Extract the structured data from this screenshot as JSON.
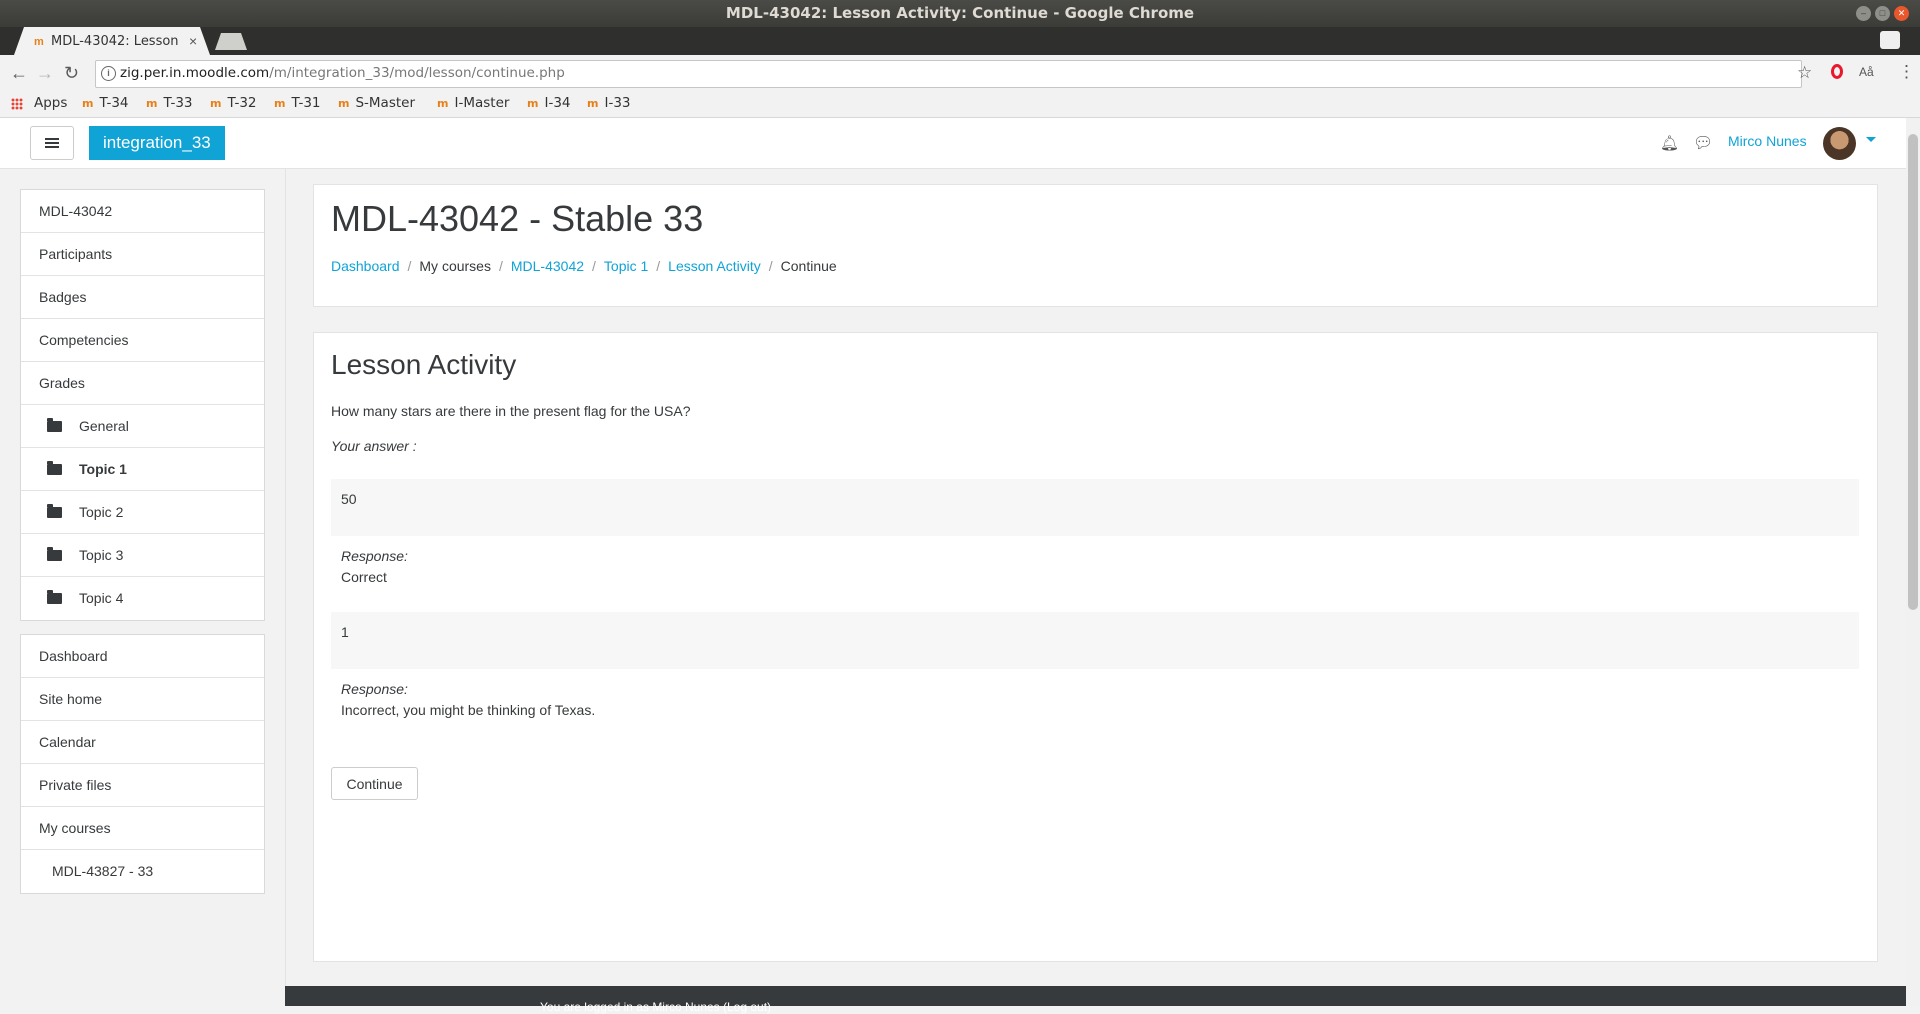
{
  "window": {
    "title": "MDL-43042: Lesson Activity: Continue - Google Chrome"
  },
  "browser": {
    "tab_title": "MDL-43042: Lesson",
    "tab_close": "×",
    "url_host": "zig.per.in.moodle.com",
    "url_path": "/m/integration_33/mod/lesson/continue.php",
    "bookmarks": [
      "Apps",
      "T-34",
      "T-33",
      "T-32",
      "T-31",
      "S-Master",
      "I-Master",
      "I-34",
      "I-33"
    ],
    "translate_label": "Aå"
  },
  "navbar": {
    "site_name": "integration_33",
    "user_name": "Mirco Nunes"
  },
  "drawer": {
    "course_items": [
      {
        "label": "MDL-43042"
      },
      {
        "label": "Participants"
      },
      {
        "label": "Badges"
      },
      {
        "label": "Competencies"
      },
      {
        "label": "Grades"
      },
      {
        "label": "General"
      },
      {
        "label": "Topic 1"
      },
      {
        "label": "Topic 2"
      },
      {
        "label": "Topic 3"
      },
      {
        "label": "Topic 4"
      }
    ],
    "site_items": [
      {
        "label": "Dashboard"
      },
      {
        "label": "Site home"
      },
      {
        "label": "Calendar"
      },
      {
        "label": "Private files"
      },
      {
        "label": "My courses"
      },
      {
        "label": "MDL-43827 - 33"
      }
    ]
  },
  "header": {
    "page_title": "MDL-43042 - Stable 33",
    "breadcrumb": [
      "Dashboard",
      "My courses",
      "MDL-43042",
      "Topic 1",
      "Lesson Activity",
      "Continue"
    ],
    "separator": "/"
  },
  "lesson": {
    "title": "Lesson Activity",
    "question": "How many stars are there in the present flag for the USA?",
    "your_answer_label": "Your answer :",
    "answers": [
      {
        "value": "50",
        "response_label": "Response:",
        "response": "Correct"
      },
      {
        "value": "1",
        "response_label": "Response:",
        "response": "Incorrect, you might be thinking of Texas."
      }
    ],
    "continue_label": "Continue"
  },
  "footer": {
    "text": "You are logged in as Mirco Nunes (Log out)"
  }
}
